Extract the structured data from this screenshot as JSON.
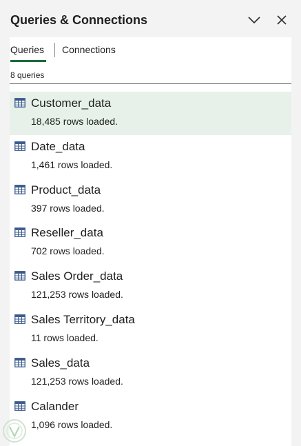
{
  "pane": {
    "title": "Queries & Connections",
    "icons": {
      "collapse": "chevron-down-icon",
      "close": "close-icon"
    }
  },
  "tabs": {
    "queries_label": "Queries",
    "connections_label": "Connections",
    "active": "Queries"
  },
  "summary": {
    "count_text": "8 queries"
  },
  "queries": [
    {
      "name": "Customer_data",
      "status": "18,485 rows loaded.",
      "selected": true
    },
    {
      "name": "Date_data",
      "status": "1,461 rows loaded."
    },
    {
      "name": "Product_data",
      "status": "397 rows loaded."
    },
    {
      "name": "Reseller_data",
      "status": "702 rows loaded."
    },
    {
      "name": "Sales Order_data",
      "status": "121,253 rows loaded."
    },
    {
      "name": "Sales Territory_data",
      "status": "11 rows loaded."
    },
    {
      "name": "Sales_data",
      "status": "121,253 rows loaded."
    },
    {
      "name": "Calander",
      "status": "1,096 rows loaded."
    }
  ],
  "colors": {
    "accent": "#1e6b3a",
    "selected_row": "#e7f1ea",
    "pane_background": "#f3f3f3",
    "table_icon": "#3a5a8c"
  }
}
